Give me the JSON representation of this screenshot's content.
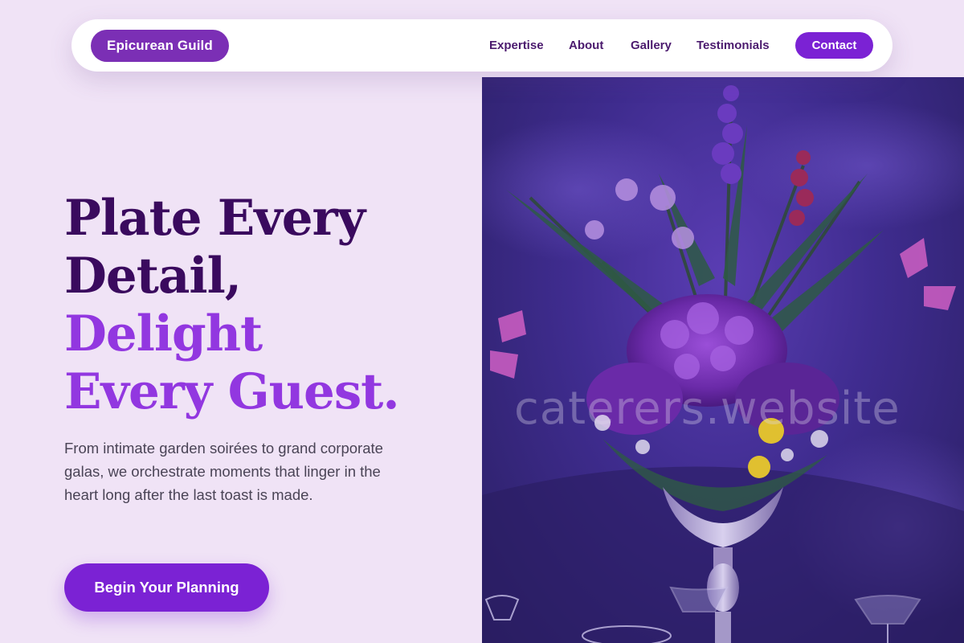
{
  "navbar": {
    "brand": "Epicurean Guild",
    "links": [
      "Expertise",
      "About",
      "Gallery",
      "Testimonials"
    ],
    "contact": "Contact"
  },
  "hero": {
    "title_line1": "Plate Every",
    "title_line2": "Detail,",
    "title_line3": "Delight",
    "title_line4": "Every Guest.",
    "description": "From intimate garden soirées to grand corporate galas, we orchestrate moments that linger in the heart long after the last toast is made.",
    "cta": "Begin Your Planning"
  },
  "image": {
    "watermark": "caterers.website"
  },
  "colors": {
    "background": "#f0e3f6",
    "brand": "#7b2fb5",
    "accent": "#7b22d4",
    "title_dark": "#3a0a5e",
    "title_light": "#9237e0"
  }
}
